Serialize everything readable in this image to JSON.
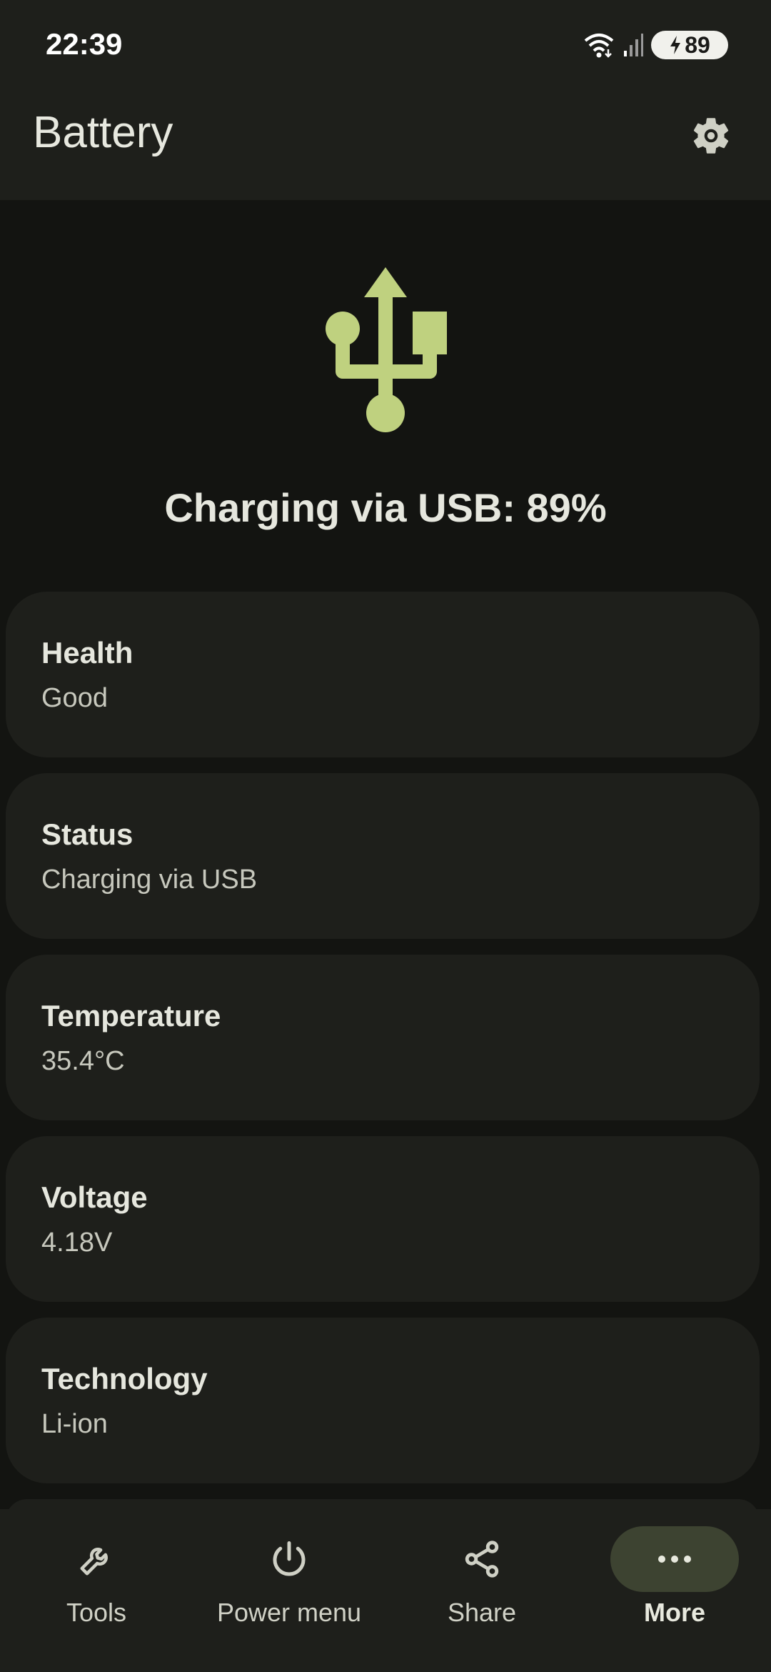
{
  "status_bar": {
    "time": "22:39",
    "battery_level": "89"
  },
  "header": {
    "title": "Battery",
    "settings_icon": "gear-icon"
  },
  "hero": {
    "icon": "usb-icon",
    "headline": "Charging via USB: 89%",
    "accent": "#bfd17f"
  },
  "cards": [
    {
      "label": "Health",
      "value": "Good"
    },
    {
      "label": "Status",
      "value": "Charging via USB"
    },
    {
      "label": "Temperature",
      "value": "35.4°C"
    },
    {
      "label": "Voltage",
      "value": "4.18V"
    },
    {
      "label": "Technology",
      "value": "Li-ion"
    }
  ],
  "bottom_nav": [
    {
      "label": "Tools",
      "icon": "wrench-icon"
    },
    {
      "label": "Power menu",
      "icon": "power-icon"
    },
    {
      "label": "Share",
      "icon": "share-icon"
    },
    {
      "label": "More",
      "icon": "more-horizontal-icon",
      "active": true
    }
  ]
}
